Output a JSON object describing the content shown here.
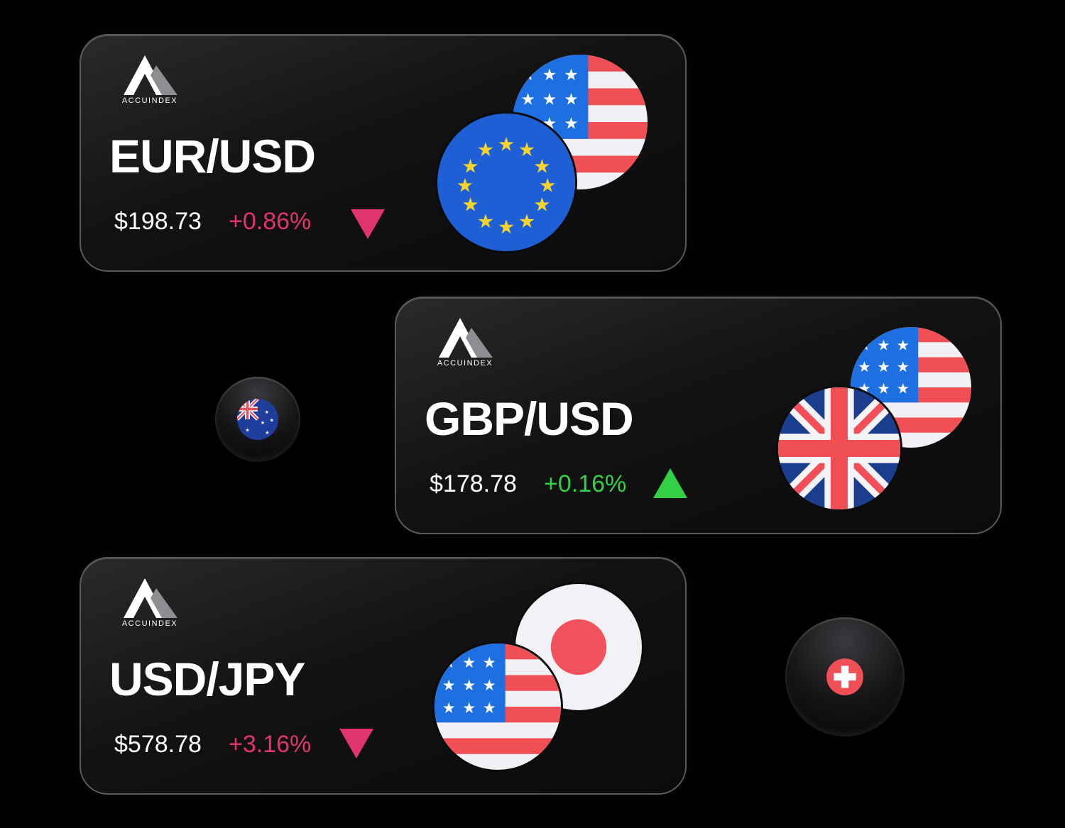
{
  "colors": {
    "negative": "#e0336f",
    "positive": "#33d046",
    "background": "#000000"
  },
  "cards": [
    {
      "brand": "ACCUINDEX",
      "pair": "EUR/USD",
      "price": "$198.73",
      "change": "+0.86%",
      "trend": "down",
      "flags": [
        "usa-flag-icon",
        "eu-flag-icon"
      ]
    },
    {
      "brand": "ACCUINDEX",
      "pair": "GBP/USD",
      "price": "$178.78",
      "change": "+0.16%",
      "trend": "up",
      "flags": [
        "usa-flag-icon",
        "uk-flag-icon"
      ]
    },
    {
      "brand": "ACCUINDEX",
      "pair": "USD/JPY",
      "price": "$578.78",
      "change": "+3.16%",
      "trend": "down",
      "flags": [
        "japan-flag-icon",
        "usa-flag-icon"
      ]
    }
  ],
  "floating_icons": [
    "australia-flag-icon",
    "switzerland-flag-icon"
  ]
}
